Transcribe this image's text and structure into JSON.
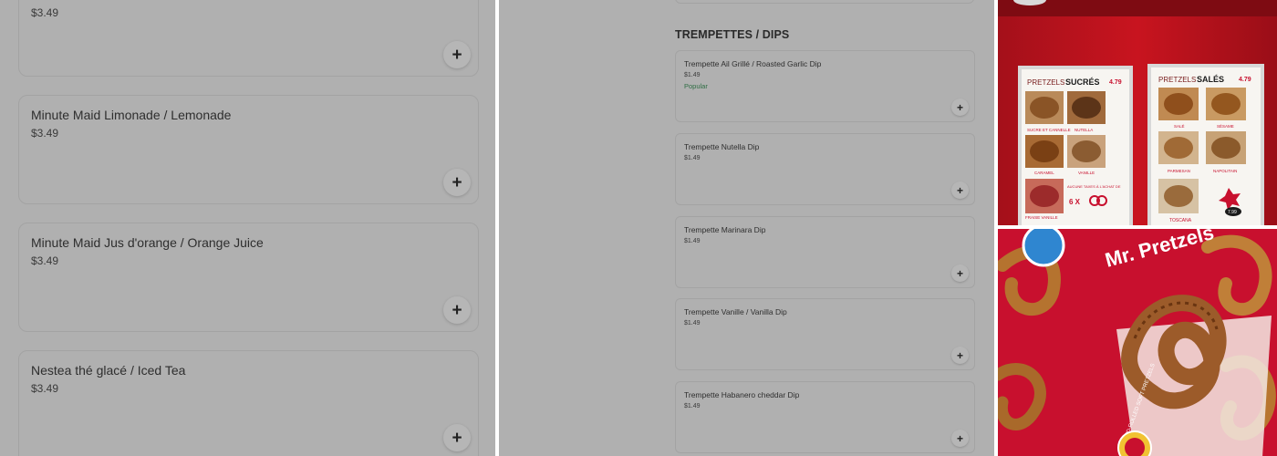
{
  "left_menu": {
    "partial_item": {
      "price": "$3.49"
    },
    "items": [
      {
        "name": "Minute Maid Limonade / Lemonade",
        "price": "$3.49"
      },
      {
        "name": "Minute Maid Jus d'orange / Orange Juice",
        "price": "$3.49"
      },
      {
        "name": "Nestea thé glacé / Iced Tea",
        "price": "$3.49"
      }
    ],
    "add_icon": "plus-icon",
    "add_label": "+"
  },
  "dips_section": {
    "title": "TREMPETTES / DIPS",
    "items": [
      {
        "name": "Trempette Ail Grillé / Roasted Garlic Dip",
        "price": "$1.49",
        "badge": "Popular"
      },
      {
        "name": "Trempette Nutella Dip",
        "price": "$1.49"
      },
      {
        "name": "Trempette Marinara Dip",
        "price": "$1.49"
      },
      {
        "name": "Trempette Vanille / Vanilla Dip",
        "price": "$1.49"
      },
      {
        "name": "Trempette Habanero cheddar Dip",
        "price": "$1.49"
      }
    ],
    "add_label": "+"
  },
  "photos": {
    "menu_board": {
      "sweet": {
        "title_a": "PRETZELS",
        "title_b": "SUCRÉS",
        "price": "4.79",
        "labels": [
          "SUCRE ET CANNELLE",
          "NUTELLA",
          "CARAMEL",
          "VANILLE",
          "FRAISE VANILLE",
          "AUCUNE TAXES À L'ACHAT DE",
          "6 X"
        ]
      },
      "savory": {
        "title_a": "PRETZELS",
        "title_b": "SALÉS",
        "price": "4.79",
        "labels": [
          "SALÉ",
          "SÉSAME",
          "PARMESAN",
          "NAPOLITAIN",
          "TOSCANA",
          "7.99"
        ]
      }
    },
    "bag_brand": "Mr. Pretzels",
    "bag_tagline": "HAND-ROLLED SOFT PRETZELS"
  },
  "colors": {
    "overlay": "#b0b0b0",
    "popular": "#2f6e44",
    "brand_red": "#c8102e"
  }
}
